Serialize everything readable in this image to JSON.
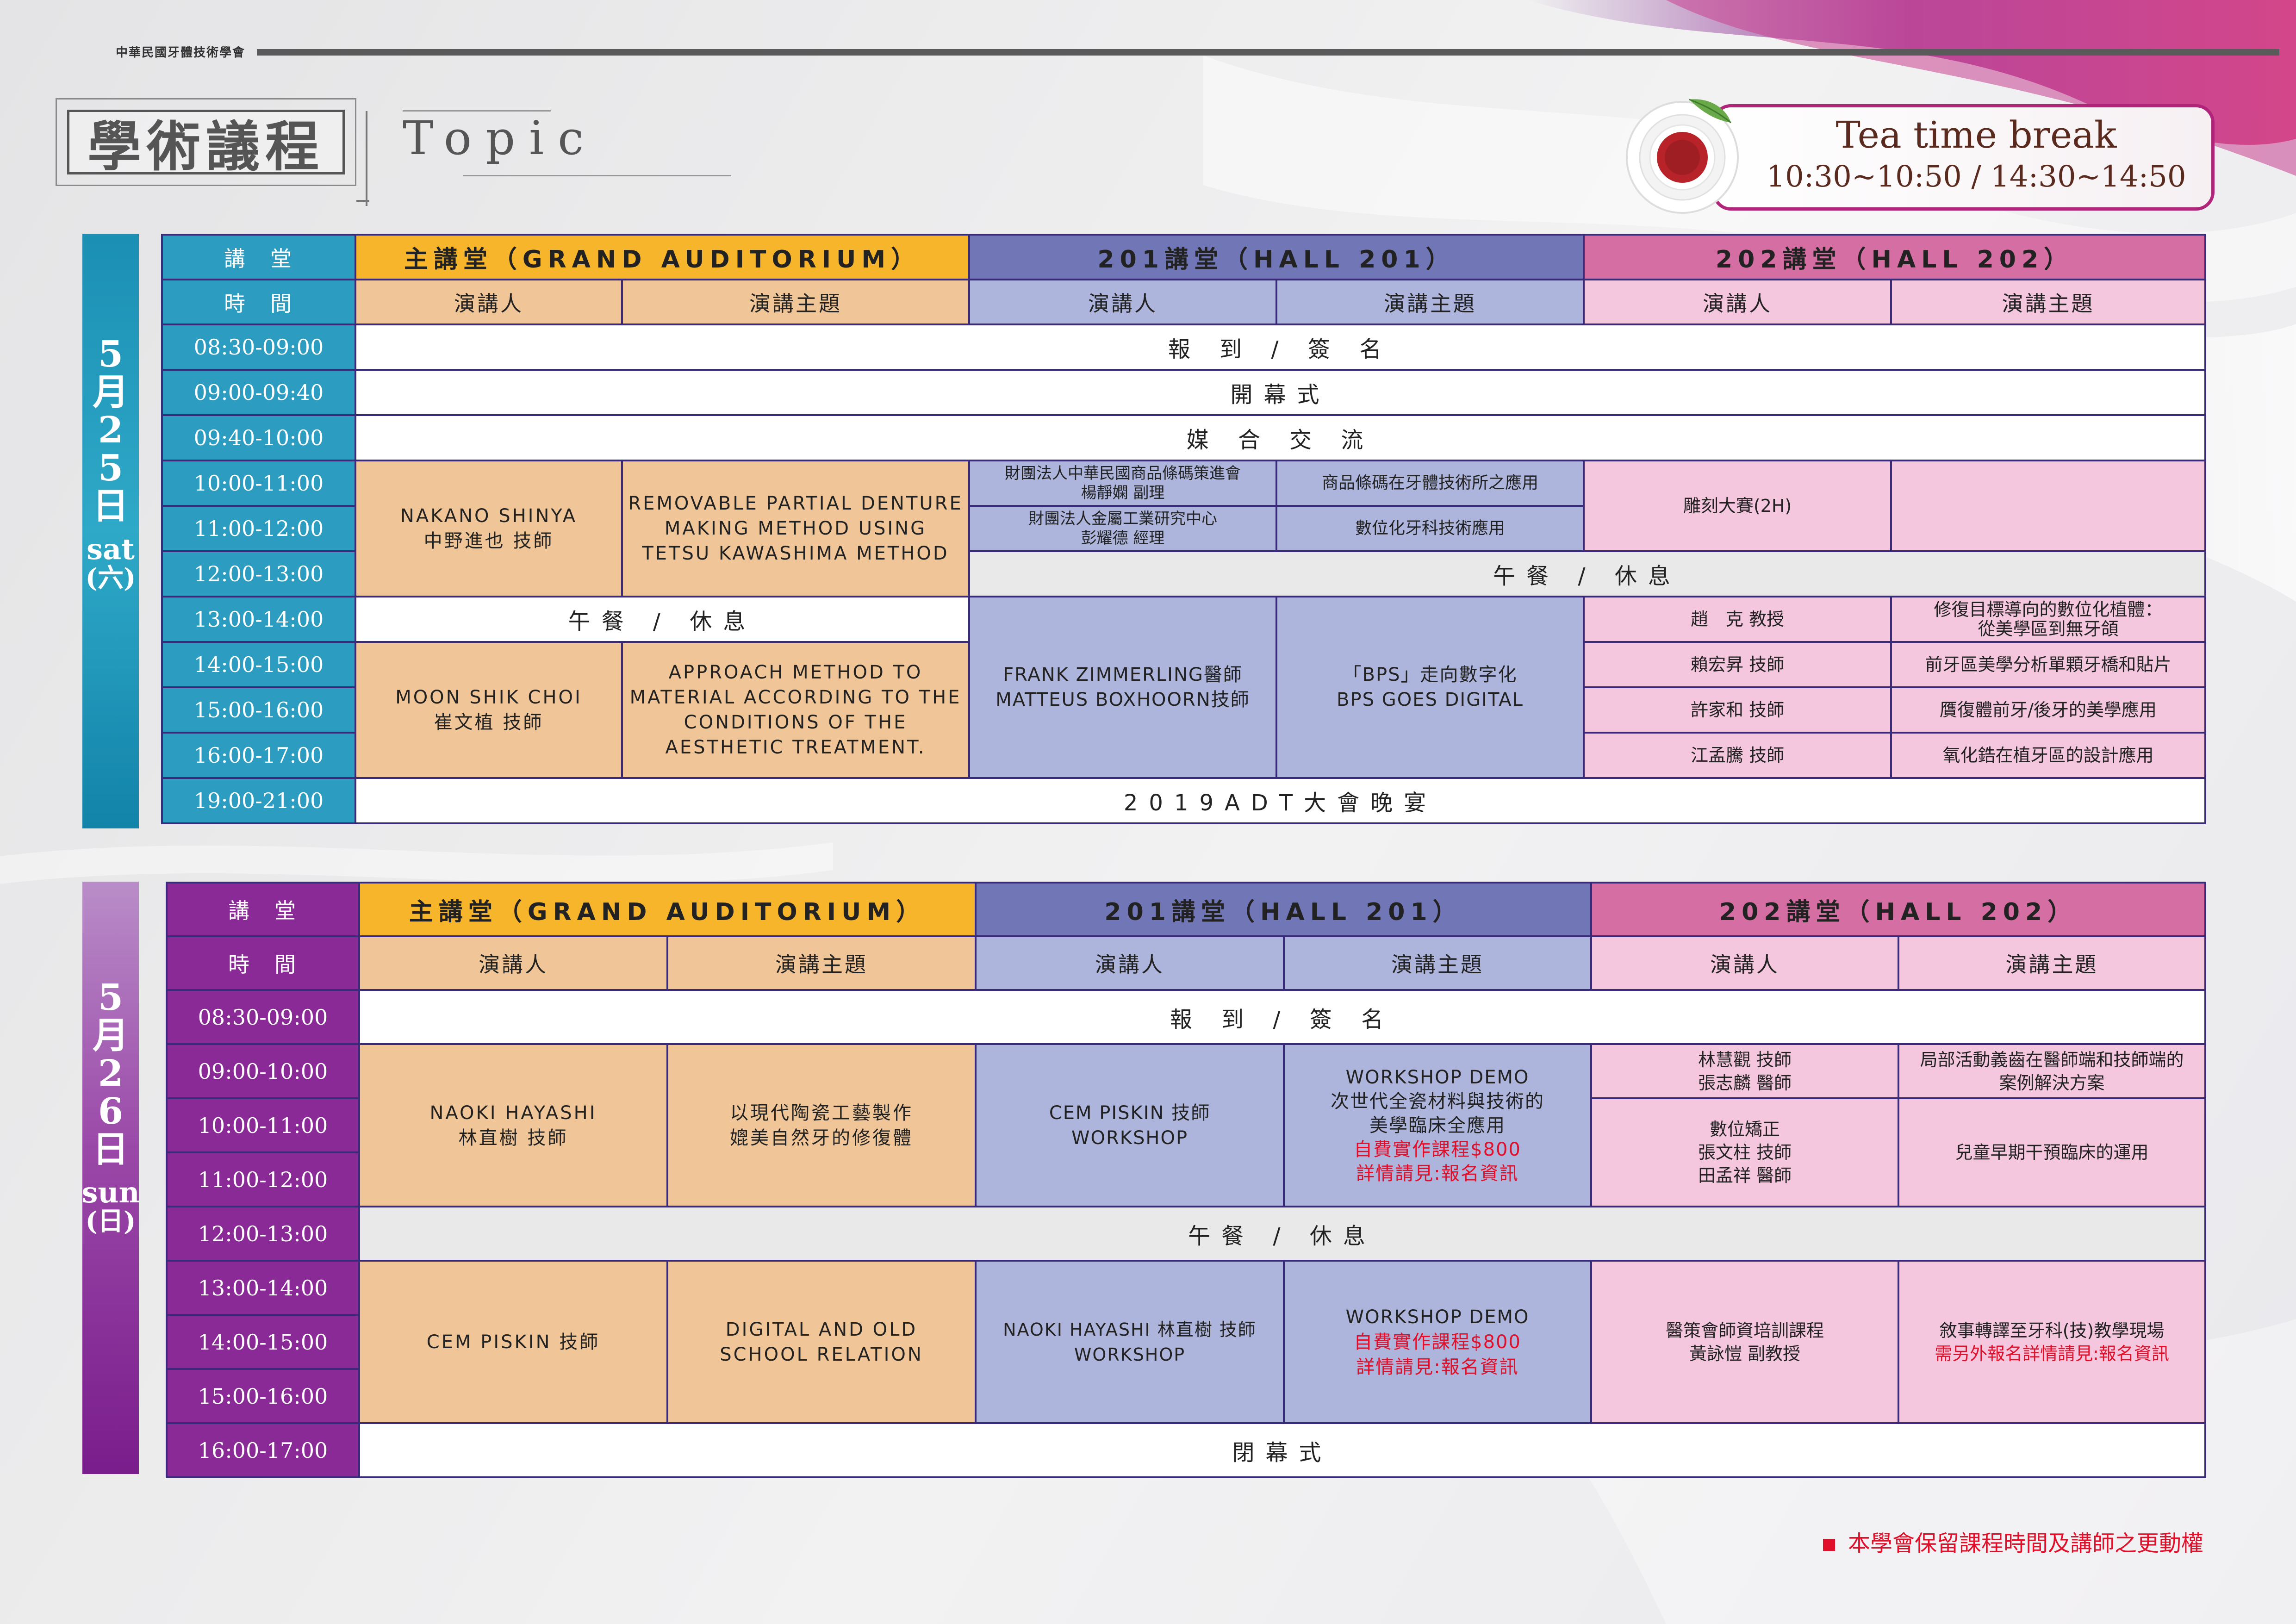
{
  "header": {
    "org": "中華民國牙體技術學會",
    "title": "學術議程",
    "topic": "Topic"
  },
  "tea_break": {
    "title": "Tea time break",
    "time": "10:30~10:50 / 14:30~14:50"
  },
  "colors": {
    "orange": "#f7b52c",
    "purple": "#7177b6",
    "pink": "#d56fa3",
    "day1": "#1d94b8",
    "day2": "#8d2c97",
    "red_text": "#e0102a"
  },
  "headers": {
    "hall_label": "講　堂",
    "time_label": "時　間",
    "grand": "主講堂（GRAND AUDITORIUM）",
    "hall201": "201講堂（HALL 201）",
    "hall202": "202講堂（HALL 202）",
    "speaker": "演講人",
    "topic": "演講主題"
  },
  "day1": {
    "date": [
      "5",
      "月",
      "2",
      "5",
      "日"
    ],
    "weekday_en": "sat",
    "weekday_zh": "(六)",
    "times": [
      "08:30-09:00",
      "09:00-09:40",
      "09:40-10:00",
      "10:00-11:00",
      "11:00-12:00",
      "12:00-13:00",
      "13:00-14:00",
      "14:00-15:00",
      "15:00-16:00",
      "16:00-17:00",
      "19:00-21:00"
    ],
    "registration": "報 到 / 簽 名",
    "opening": "開幕式",
    "networking": "媒 合 交 流",
    "lunch": "午餐 / 休息",
    "banquet": "2019ADT大會晚宴",
    "grand_1_speaker": [
      "NAKANO SHINYA",
      "中野進也 技師"
    ],
    "grand_1_topic": [
      "REMOVABLE PARTIAL DENTURE",
      "MAKING METHOD USING",
      "TETSU KAWASHIMA METHOD"
    ],
    "grand_2_speaker": [
      "MOON SHIK CHOI",
      "崔文植 技師"
    ],
    "grand_2_topic": [
      "APPROACH METHOD TO",
      "MATERIAL ACCORDING TO THE",
      "CONDITIONS OF THE",
      "AESTHETIC TREATMENT."
    ],
    "h201_1_speaker": [
      "財團法人中華民國商品條碼策進會",
      "楊靜嫻 副理"
    ],
    "h201_1_topic": "商品條碼在牙體技術所之應用",
    "h201_2_speaker": [
      "財團法人金屬工業研究中心",
      "彭耀德 經理"
    ],
    "h201_2_topic": "數位化牙科技術應用",
    "h201_3_speaker": [
      "FRANK ZIMMERLING醫師",
      "MATTEUS BOXHOORN技師"
    ],
    "h201_3_topic": [
      "「BPS」走向數字化",
      "BPS GOES DIGITAL"
    ],
    "h202_1_speaker": "雕刻大賽(2H)",
    "h202_rows": [
      {
        "speaker": "趙　克 教授",
        "topic": [
          "修復目標導向的數位化植體：",
          "從美學區到無牙頜"
        ]
      },
      {
        "speaker": "賴宏昇 技師",
        "topic": [
          "前牙區美學分析單顆牙橋和貼片"
        ]
      },
      {
        "speaker": "許家和 技師",
        "topic": [
          "贋復體前牙/後牙的美學應用"
        ]
      },
      {
        "speaker": "江孟騰 技師",
        "topic": [
          "氧化鋯在植牙區的設計應用"
        ]
      }
    ]
  },
  "day2": {
    "date": [
      "5",
      "月",
      "2",
      "6",
      "日"
    ],
    "weekday_en": "sun",
    "weekday_zh": "(日)",
    "times": [
      "08:30-09:00",
      "09:00-10:00",
      "10:00-11:00",
      "11:00-12:00",
      "12:00-13:00",
      "13:00-14:00",
      "14:00-15:00",
      "15:00-16:00",
      "16:00-17:00"
    ],
    "registration": "報 到 / 簽 名",
    "lunch": "午餐 / 休息",
    "closing": "閉幕式",
    "grand_1_speaker": [
      "NAOKI HAYASHI",
      "林直樹 技師"
    ],
    "grand_1_topic": [
      "以現代陶瓷工藝製作",
      "媲美自然牙的修復體"
    ],
    "grand_2_speaker": "CEM PISKIN 技師",
    "grand_2_topic": [
      "DIGITAL AND OLD",
      "SCHOOL RELATION"
    ],
    "h201_1_speaker": [
      "CEM PISKIN 技師",
      "WORKSHOP"
    ],
    "h201_1_topic": [
      "WORKSHOP DEMO",
      "次世代全瓷材料與技術的",
      "美學臨床全應用"
    ],
    "h201_1_topic_red": [
      "自費實作課程$800",
      "詳情請見:報名資訊"
    ],
    "h201_2_speaker": [
      "NAOKI HAYASHI 林直樹 技師",
      "WORKSHOP"
    ],
    "h201_2_topic": "WORKSHOP DEMO",
    "h201_2_topic_red": [
      "自費實作課程$800",
      "詳情請見:報名資訊"
    ],
    "h202_1_speaker": [
      "林慧觀 技師",
      "張志麟 醫師"
    ],
    "h202_1_topic": [
      "局部活動義齒在醫師端和技師端的",
      "案例解決方案"
    ],
    "h202_2_speaker": [
      "數位矯正",
      "張文柱 技師",
      "田孟祥 醫師"
    ],
    "h202_2_topic": "兒童早期干預臨床的運用",
    "h202_3_speaker": [
      "醫策會師資培訓課程",
      "黃詠愷 副教授"
    ],
    "h202_3_topic": "敘事轉譯至牙科(技)教學現場",
    "h202_3_topic_red": "需另外報名詳情請見:報名資訊"
  },
  "footer_note": "本學會保留課程時間及講師之更動權"
}
